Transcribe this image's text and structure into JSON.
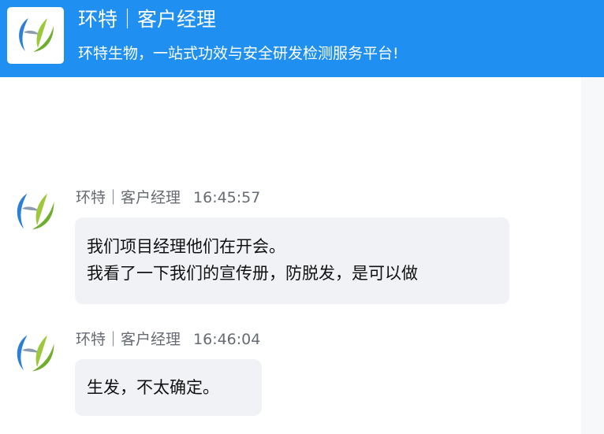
{
  "header": {
    "title": "环特｜客户经理",
    "subtitle": "环特生物，一站式功效与安全研发检测服务平台!"
  },
  "messages": [
    {
      "sender": "环特｜客户经理",
      "time": "16:45:57",
      "lines": [
        "我们项目经理他们在开会。",
        "我看了一下我们的宣传册，防脱发，是可以做"
      ]
    },
    {
      "sender": "环特｜客户经理",
      "time": "16:46:04",
      "lines": [
        "生发，不太确定。"
      ]
    }
  ],
  "colors": {
    "header_bg": "#1f8ff1",
    "bubble_bg": "#f0f2f5",
    "logo_blue": "#2b7fd6",
    "logo_green": "#7dbb2e"
  },
  "icons": {
    "logo": "company-logo-icon",
    "avatar": "agent-avatar-icon"
  }
}
